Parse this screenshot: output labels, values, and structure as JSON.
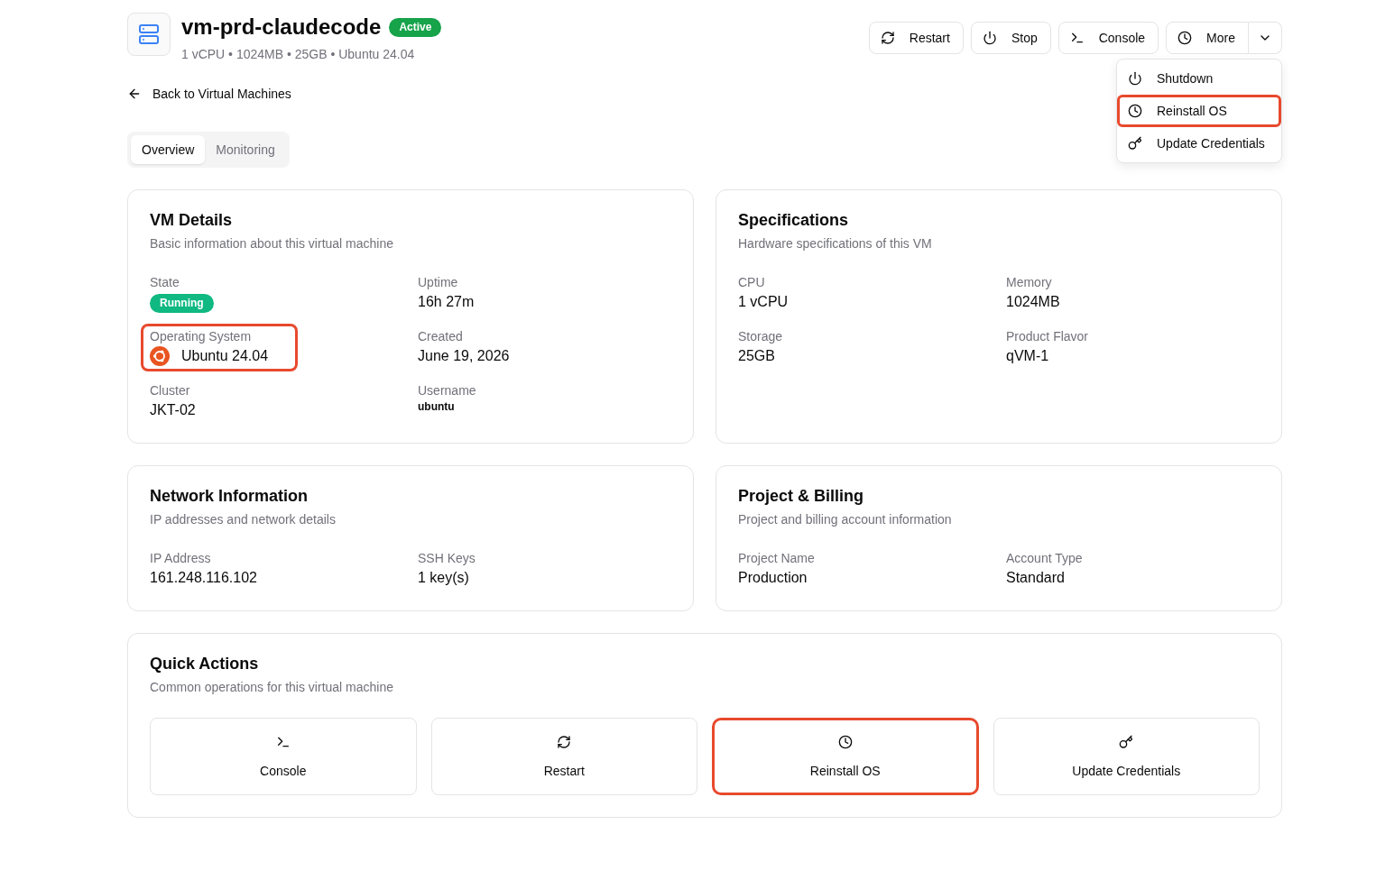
{
  "header": {
    "title": "vm-prd-claudecode",
    "status": "Active",
    "subtitle": "1 vCPU • 1024MB • 25GB • Ubuntu 24.04"
  },
  "toolbar": {
    "buttons": [
      {
        "label": "Restart",
        "kind": "restart"
      },
      {
        "label": "Stop",
        "kind": "stop"
      },
      {
        "label": "Console",
        "kind": "console"
      }
    ],
    "more": {
      "label": "More",
      "expanded": true,
      "menu": [
        {
          "label": "Shutdown",
          "kind": "shutdown",
          "highlighted": false
        },
        {
          "label": "Reinstall OS",
          "kind": "reinstall",
          "highlighted": true
        },
        {
          "label": "Update Credentials",
          "kind": "credentials",
          "highlighted": false
        }
      ]
    }
  },
  "back_link": "Back to Virtual Machines",
  "tabs": [
    {
      "label": "Overview",
      "selected": true
    },
    {
      "label": "Monitoring",
      "selected": false
    }
  ],
  "cards": [
    {
      "title": "VM Details",
      "description": "Basic information about this virtual machine",
      "fields": [
        {
          "label": "State",
          "value": "Running",
          "kind": "status",
          "highlighted": false
        },
        {
          "label": "Uptime",
          "value": "16h 27m",
          "kind": "text",
          "highlighted": false
        },
        {
          "label": "Operating System",
          "value": "Ubuntu 24.04",
          "kind": "os",
          "highlighted": true
        },
        {
          "label": "Created",
          "value": "June 19, 2026",
          "kind": "text",
          "highlighted": false
        },
        {
          "label": "Cluster",
          "value": "JKT-02",
          "kind": "text",
          "highlighted": false
        },
        {
          "label": "Username",
          "value": "ubuntu",
          "kind": "note",
          "highlighted": false
        }
      ]
    },
    {
      "title": "Specifications",
      "description": "Hardware specifications of this VM",
      "fields": [
        {
          "label": "CPU",
          "value": "1 vCPU",
          "kind": "text",
          "highlighted": false
        },
        {
          "label": "Memory",
          "value": "1024MB",
          "kind": "text",
          "highlighted": false
        },
        {
          "label": "Storage",
          "value": "25GB",
          "kind": "text",
          "highlighted": false
        },
        {
          "label": "Product Flavor",
          "value": "qVM-1",
          "kind": "text",
          "highlighted": false
        }
      ]
    },
    {
      "title": "Network Information",
      "description": "IP addresses and network details",
      "fields": [
        {
          "label": "IP Address",
          "value": "161.248.116.102",
          "kind": "text",
          "highlighted": false
        },
        {
          "label": "SSH Keys",
          "value": "1 key(s)",
          "kind": "text",
          "highlighted": false
        }
      ]
    },
    {
      "title": "Project & Billing",
      "description": "Project and billing account information",
      "fields": [
        {
          "label": "Project Name",
          "value": "Production",
          "kind": "text",
          "highlighted": false
        },
        {
          "label": "Account Type",
          "value": "Standard",
          "kind": "text",
          "highlighted": false
        }
      ]
    }
  ],
  "quick_actions": {
    "title": "Quick Actions",
    "description": "Common operations for this virtual machine",
    "items": [
      {
        "label": "Console",
        "kind": "console",
        "highlighted": false
      },
      {
        "label": "Restart",
        "kind": "restart",
        "highlighted": false
      },
      {
        "label": "Reinstall OS",
        "kind": "reinstall",
        "highlighted": true
      },
      {
        "label": "Update Credentials",
        "kind": "credentials",
        "highlighted": false
      }
    ]
  }
}
